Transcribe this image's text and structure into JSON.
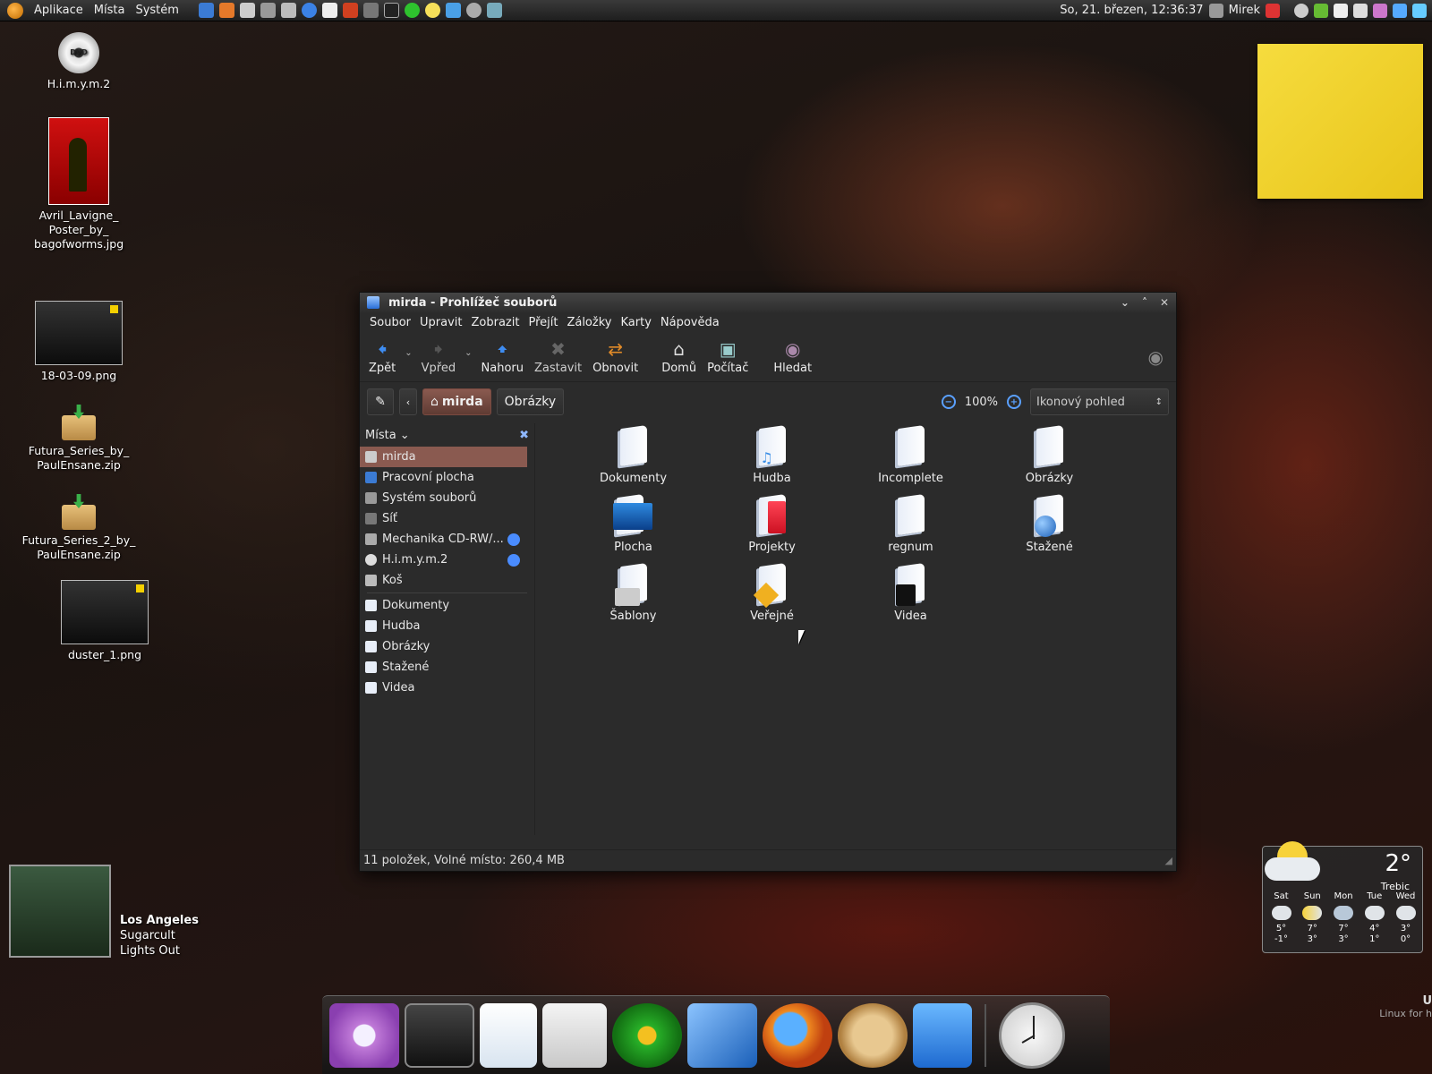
{
  "top_panel": {
    "menus": [
      "Aplikace",
      "Místa",
      "Systém"
    ],
    "datetime": "So, 21. březen, 12:36:37",
    "user": "Mirek",
    "colors": {
      "panel": "#2a2a2a"
    }
  },
  "desktop_icons": [
    {
      "label": "H.i.m.y.m.2",
      "icon": "dvd-icon"
    },
    {
      "label": "Avril_Lavigne_ Poster_by_ bagofworms.jpg",
      "icon": "image-thumbnail-icon"
    },
    {
      "label": "18-03-09.png",
      "icon": "image-thumbnail-icon"
    },
    {
      "label": "Futura_Series_by_ PaulEnsane.zip",
      "icon": "archive-icon"
    },
    {
      "label": "Futura_Series_2_by_ PaulEnsane.zip",
      "icon": "archive-icon"
    },
    {
      "label": "duster_1.png",
      "icon": "image-thumbnail-icon"
    }
  ],
  "window": {
    "title": "mirda - Prohlížeč souborů",
    "menubar": [
      "Soubor",
      "Upravit",
      "Zobrazit",
      "Přejít",
      "Záložky",
      "Karty",
      "Nápověda"
    ],
    "toolbar": {
      "back": "Zpět",
      "forward": "Vpřed",
      "up": "Nahoru",
      "stop": "Zastavit",
      "reload": "Obnovit",
      "home": "Domů",
      "computer": "Počítač",
      "search": "Hledat"
    },
    "pathbar": {
      "current": "mirda",
      "next": "Obrázky",
      "zoom": "100%",
      "view_mode": "Ikonový pohled"
    },
    "sidebar": {
      "heading": "Místa",
      "places": [
        {
          "label": "mirda",
          "selected": true
        },
        {
          "label": "Pracovní plocha"
        },
        {
          "label": "Systém souborů"
        },
        {
          "label": "Síť"
        },
        {
          "label": "Mechanika CD-RW/...",
          "eject": true
        },
        {
          "label": "H.i.m.y.m.2",
          "eject": true
        },
        {
          "label": "Koš"
        }
      ],
      "bookmarks": [
        "Dokumenty",
        "Hudba",
        "Obrázky",
        "Stažené",
        "Videa"
      ]
    },
    "items": [
      {
        "label": "Dokumenty",
        "icon": "folder-documents-icon"
      },
      {
        "label": "Hudba",
        "icon": "folder-music-icon"
      },
      {
        "label": "Incomplete",
        "icon": "folder-icon"
      },
      {
        "label": "Obrázky",
        "icon": "folder-pictures-icon"
      },
      {
        "label": "Plocha",
        "icon": "folder-desktop-icon"
      },
      {
        "label": "Projekty",
        "icon": "folder-red-icon"
      },
      {
        "label": "regnum",
        "icon": "folder-icon"
      },
      {
        "label": "Stažené",
        "icon": "folder-downloads-icon"
      },
      {
        "label": "Šablony",
        "icon": "folder-templates-icon"
      },
      {
        "label": "Veřejné",
        "icon": "folder-public-icon"
      },
      {
        "label": "Videa",
        "icon": "folder-videos-icon"
      }
    ],
    "status": "11 položek, Volné místo: 260,4 MB"
  },
  "music": {
    "song": "Los Angeles",
    "artist": "Sugarcult",
    "album": "Lights Out"
  },
  "weather": {
    "temp": "2°",
    "city": "Trebic",
    "forecast": [
      {
        "day": "Sat",
        "hi": "5°",
        "lo": "-1°"
      },
      {
        "day": "Sun",
        "hi": "7°",
        "lo": "3°"
      },
      {
        "day": "Mon",
        "hi": "7°",
        "lo": "3°"
      },
      {
        "day": "Tue",
        "hi": "4°",
        "lo": "1°"
      },
      {
        "day": "Wed",
        "hi": "3°",
        "lo": "0°"
      }
    ]
  },
  "dock": {
    "items": [
      "system-settings-icon",
      "terminal-icon",
      "text-editor-icon",
      "gparted-icon",
      "icq-icon",
      "writer-icon",
      "firefox-icon",
      "gimp-icon",
      "file-manager-icon",
      "clock-icon"
    ]
  },
  "corner": {
    "line1": "U",
    "line2": "Linux for h"
  }
}
